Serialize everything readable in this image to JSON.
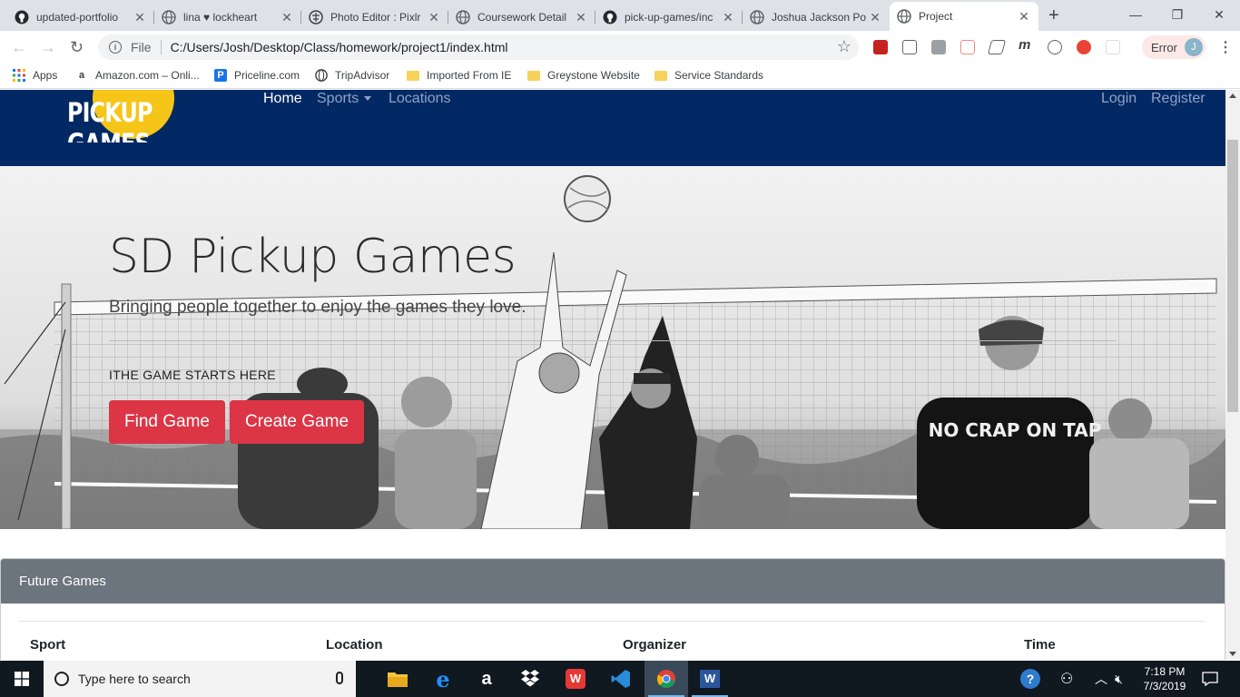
{
  "browser": {
    "tabs": [
      {
        "title": "updated-portfolio",
        "icon": "github-icon"
      },
      {
        "title": "lina ♥ lockheart",
        "icon": "globe-icon"
      },
      {
        "title": "Photo Editor : Pixlr",
        "icon": "pixlr-icon"
      },
      {
        "title": "Coursework Detail",
        "icon": "globe-icon"
      },
      {
        "title": "pick-up-games/inc",
        "icon": "github-icon"
      },
      {
        "title": "Joshua Jackson Po",
        "icon": "globe-icon"
      },
      {
        "title": "Project",
        "icon": "globe-icon",
        "active": true
      }
    ],
    "address": {
      "scheme_label": "File",
      "url": "C:/Users/Josh/Desktop/Class/homework/project1/index.html"
    },
    "profile": {
      "status": "Error",
      "initial": "J"
    },
    "bookmarks": [
      {
        "label": "Apps",
        "icon": "apps-grid-icon"
      },
      {
        "label": "Amazon.com – Onli...",
        "icon": "amazon-icon"
      },
      {
        "label": "Priceline.com",
        "icon": "priceline-icon"
      },
      {
        "label": "TripAdvisor",
        "icon": "globe-icon"
      },
      {
        "label": "Imported From IE",
        "icon": "folder-icon"
      },
      {
        "label": "Greystone Website",
        "icon": "folder-icon"
      },
      {
        "label": "Service Standards",
        "icon": "folder-icon"
      }
    ]
  },
  "site": {
    "logo_text": "PICKUP GAMES",
    "nav": {
      "home": "Home",
      "sports": "Sports",
      "locations": "Locations",
      "login": "Login",
      "register": "Register"
    },
    "hero": {
      "title": "SD Pickup Games",
      "subtitle": "Bringing people together to enjoy the games they love.",
      "tagline": "ITHE GAME STARTS HERE",
      "find_button": "Find Game",
      "create_button": "Create Game"
    },
    "shirt_text": "NO CRAP ON TAP",
    "card": {
      "header": "Future Games",
      "columns": [
        "Sport",
        "Location",
        "Organizer",
        "Time"
      ]
    }
  },
  "taskbar": {
    "search_placeholder": "Type here to search",
    "clock_time": "7:18 PM",
    "clock_date": "7/3/2019"
  },
  "colors": {
    "navbar": "#032964",
    "accent_button": "#dc3545",
    "card_header": "#6c757d",
    "logo_yellow": "#f5c518"
  }
}
